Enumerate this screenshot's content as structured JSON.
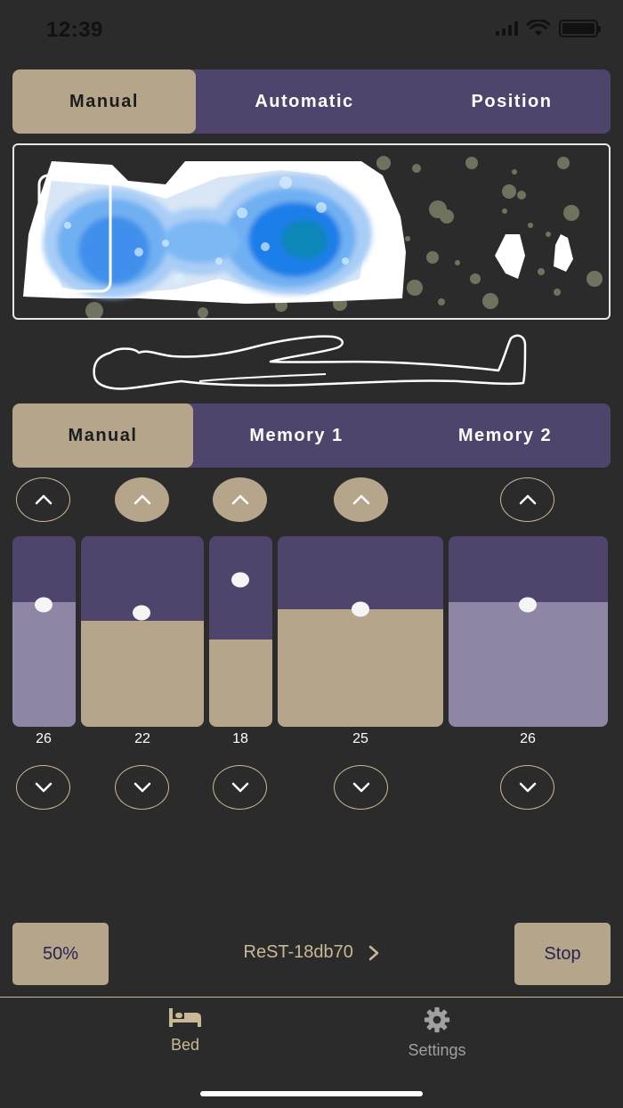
{
  "status_bar": {
    "time": "12:39"
  },
  "mode_tabs": [
    {
      "label": "Manual",
      "active": true
    },
    {
      "label": "Automatic",
      "active": false
    },
    {
      "label": "Position",
      "active": false
    }
  ],
  "memory_tabs": [
    {
      "label": "Manual",
      "active": true
    },
    {
      "label": "Memory 1",
      "active": false
    },
    {
      "label": "Memory 2",
      "active": false
    }
  ],
  "zones": [
    {
      "value": "26",
      "up_filled": false
    },
    {
      "value": "22",
      "up_filled": true
    },
    {
      "value": "18",
      "up_filled": true
    },
    {
      "value": "25",
      "up_filled": true
    },
    {
      "value": "26",
      "up_filled": false
    }
  ],
  "footer": {
    "speed_label": "50%",
    "device_name": "ReST-18db70",
    "stop_label": "Stop"
  },
  "tab_bar": {
    "bed_label": "Bed",
    "settings_label": "Settings"
  },
  "colors": {
    "background": "#2b2b2b",
    "purple": "#4f456c",
    "tan": "#b5a68b",
    "lilac": "#8f86a5",
    "gold_text": "#c9b896"
  }
}
